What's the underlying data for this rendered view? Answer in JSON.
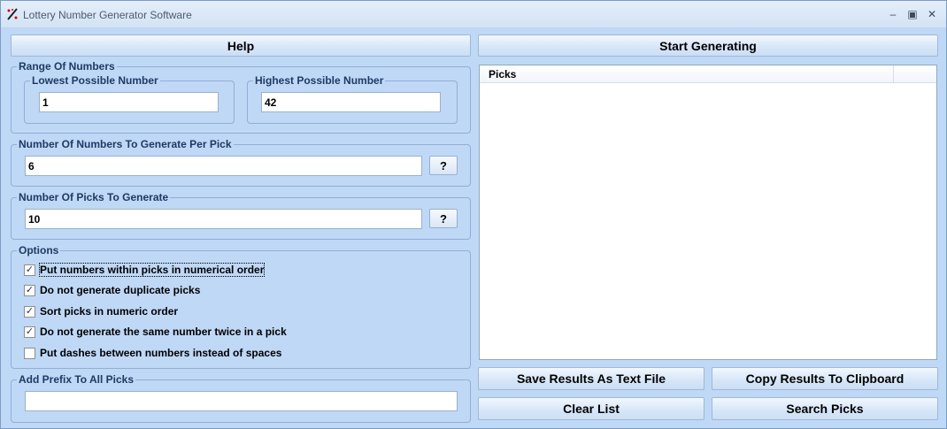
{
  "window": {
    "title": "Lottery Number Generator Software"
  },
  "buttons": {
    "help": "Help",
    "start": "Start Generating",
    "save": "Save Results As Text File",
    "copy": "Copy Results To Clipboard",
    "clear": "Clear List",
    "search": "Search Picks",
    "question": "?"
  },
  "range": {
    "legend": "Range Of Numbers",
    "lowest_legend": "Lowest Possible Number",
    "lowest_value": "1",
    "highest_legend": "Highest Possible Number",
    "highest_value": "42"
  },
  "per_pick": {
    "legend": "Number Of Numbers To Generate Per Pick",
    "value": "6"
  },
  "picks_count": {
    "legend": "Number Of Picks To Generate",
    "value": "10"
  },
  "options": {
    "legend": "Options",
    "items": [
      {
        "label": "Put numbers within picks in numerical order",
        "checked": true
      },
      {
        "label": "Do not generate duplicate picks",
        "checked": true
      },
      {
        "label": "Sort picks in numeric order",
        "checked": true
      },
      {
        "label": "Do not generate the same number twice in a pick",
        "checked": true
      },
      {
        "label": "Put dashes between numbers instead of spaces",
        "checked": false
      }
    ]
  },
  "prefix": {
    "legend": "Add Prefix To All Picks",
    "value": ""
  },
  "list": {
    "column": "Picks"
  }
}
